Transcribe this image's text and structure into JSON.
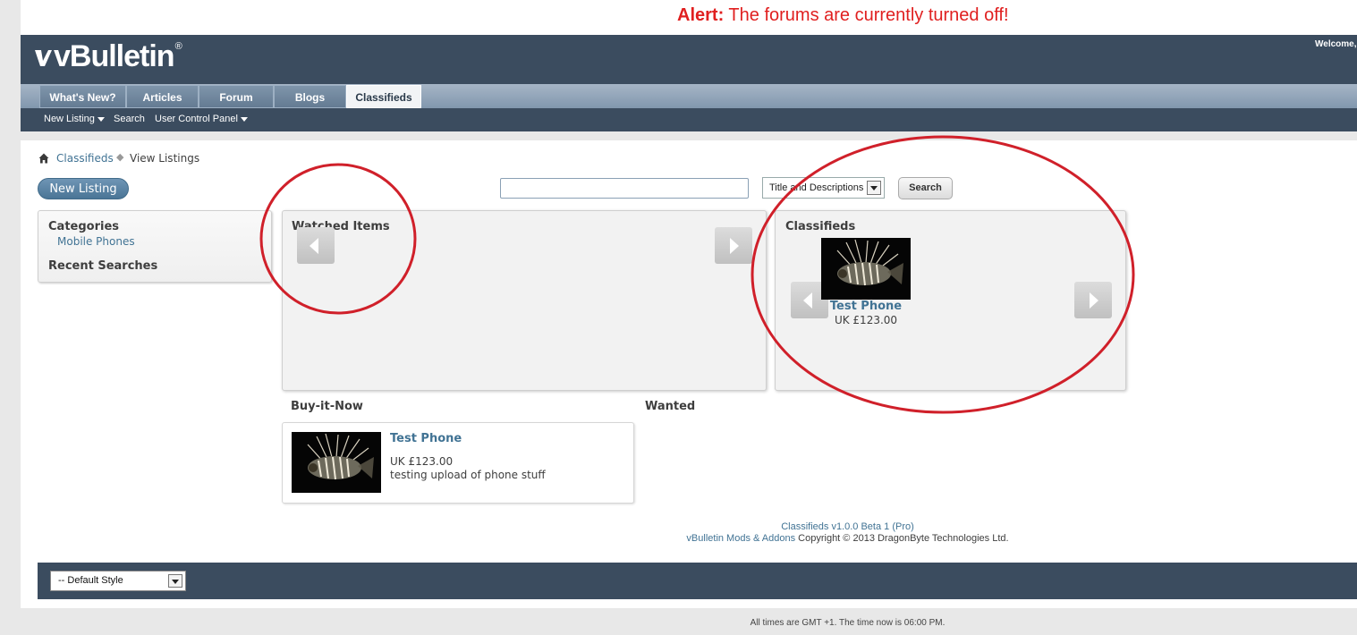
{
  "alert": {
    "label": "Alert:",
    "message": " The forums are currently turned off!"
  },
  "header": {
    "logo_text": "vBulletin",
    "logo_mark": "®",
    "welcome": "Welcome,"
  },
  "tabs": [
    {
      "label": "What's New?"
    },
    {
      "label": "Articles"
    },
    {
      "label": "Forum"
    },
    {
      "label": "Blogs"
    },
    {
      "label": "Classifieds",
      "selected": true
    }
  ],
  "subnav": {
    "new_listing": "New Listing",
    "search": "Search",
    "user_cp": "User Control Panel"
  },
  "breadcrumb": {
    "item1": "Classifieds",
    "item2": "View Listings"
  },
  "toolbar": {
    "new_listing_button": "New Listing",
    "search_value": "",
    "search_select": "Title and Descriptions",
    "search_button": "Search"
  },
  "sidebar": {
    "categories_title": "Categories",
    "category_1": "Mobile Phones",
    "recent_title": "Recent Searches"
  },
  "watched": {
    "title": "Watched Items"
  },
  "classifieds": {
    "title": "Classifieds",
    "item_title": "Test Phone",
    "item_price": "UK £123.00"
  },
  "buy_it_now": {
    "title": "Buy-it-Now",
    "item_title": "Test Phone",
    "item_price": "UK £123.00",
    "item_desc": "testing upload of phone stuff"
  },
  "wanted": {
    "title": "Wanted"
  },
  "credits": {
    "line1": "Classifieds v1.0.0 Beta 1 (Pro)",
    "line2_link": "vBulletin Mods & Addons",
    "line2_rest": " Copyright © 2013 DragonByte Technologies Ltd."
  },
  "footer": {
    "style_select": "-- Default Style",
    "time_prefix": "All times are GMT +1. The time now is ",
    "time_value": "06:00 PM",
    "time_suffix": "."
  },
  "colors": {
    "alert": "#e01f1f",
    "header": "#3b4c5f",
    "link": "#417394",
    "annotation": "#d0202a"
  },
  "icons": [
    "home-icon",
    "chevron-down-icon",
    "arrow-left-icon",
    "arrow-right-icon",
    "lionfish-thumbnail"
  ]
}
